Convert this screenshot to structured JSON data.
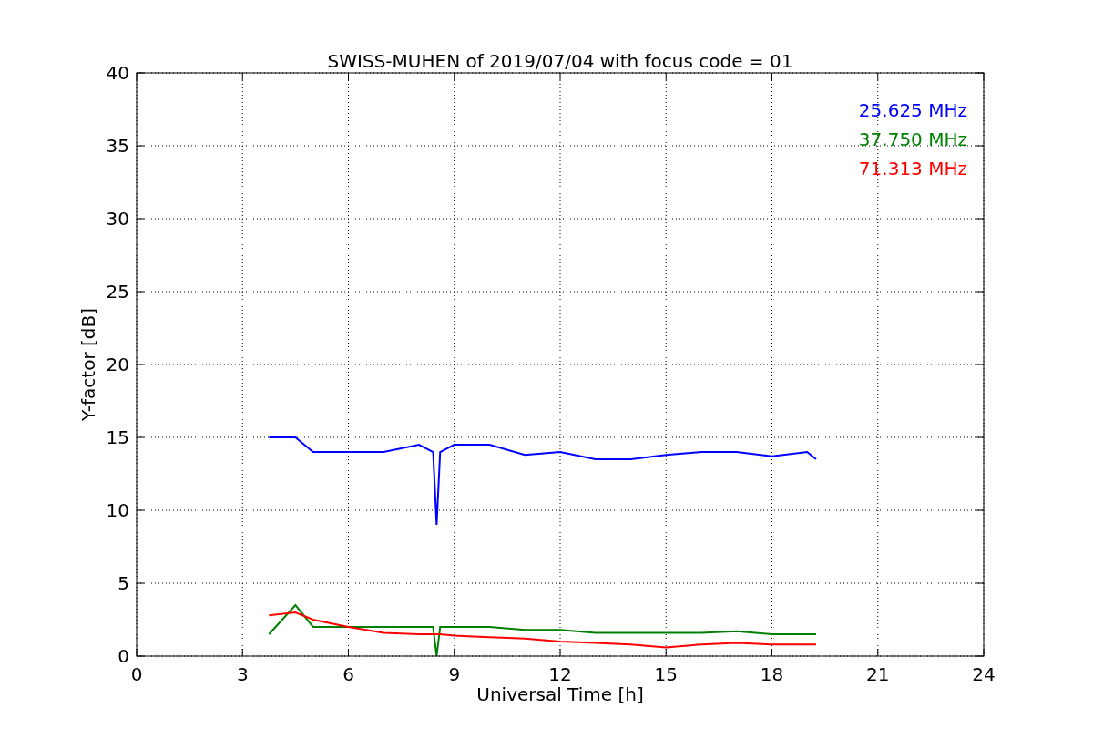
{
  "chart_data": {
    "type": "line",
    "title": "SWISS-MUHEN of 2019/07/04 with focus code = 01",
    "xlabel": "Universal Time [h]",
    "ylabel": "Y-factor [dB]",
    "grid": true,
    "xlim": [
      0,
      24
    ],
    "ylim": [
      0,
      40
    ],
    "xticks": [
      0,
      3,
      6,
      9,
      12,
      15,
      18,
      21,
      24
    ],
    "yticks": [
      0,
      5,
      10,
      15,
      20,
      25,
      30,
      35,
      40
    ],
    "x": [
      3.75,
      4.5,
      5,
      6,
      7,
      8,
      8.4,
      8.5,
      8.6,
      9,
      10,
      11,
      12,
      13,
      14,
      15,
      16,
      17,
      18,
      19,
      19.25
    ],
    "series": [
      {
        "name": "25.625 MHz",
        "color": "#0000ff",
        "values": [
          15,
          15,
          14,
          14,
          14,
          14.5,
          14,
          9,
          14,
          14.5,
          14.5,
          13.8,
          14,
          13.5,
          13.5,
          13.8,
          14,
          14,
          13.7,
          14,
          13.5
        ]
      },
      {
        "name": "37.750 MHz",
        "color": "#008000",
        "values": [
          1.5,
          3.5,
          2,
          2,
          2,
          2,
          2,
          0,
          2,
          2,
          2,
          1.8,
          1.8,
          1.6,
          1.6,
          1.6,
          1.6,
          1.7,
          1.5,
          1.5,
          1.5
        ]
      },
      {
        "name": "71.313 MHz",
        "color": "#ff0000",
        "values": [
          2.8,
          3,
          2.5,
          2,
          1.6,
          1.5,
          1.5,
          1.5,
          1.5,
          1.4,
          1.3,
          1.2,
          1,
          0.9,
          0.8,
          0.6,
          0.8,
          0.9,
          0.8,
          0.8,
          0.8
        ]
      }
    ]
  }
}
